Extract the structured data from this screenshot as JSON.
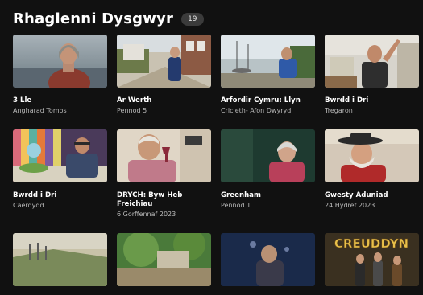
{
  "header": {
    "title": "Rhaglenni Dysgwyr",
    "count": "19"
  },
  "cards": [
    {
      "title": "3 Lle",
      "subtitle": "Angharad Tomos",
      "subtitle2": ""
    },
    {
      "title": "Ar Werth",
      "subtitle": "Pennod 5",
      "subtitle2": ""
    },
    {
      "title": "Arfordir Cymru: Llyn",
      "subtitle": "Cricieth- Afon Dwyryd",
      "subtitle2": ""
    },
    {
      "title": "Bwrdd i Dri",
      "subtitle": "Tregaron",
      "subtitle2": ""
    },
    {
      "title": "Bwrdd i Dri",
      "subtitle": "Caerdydd",
      "subtitle2": ""
    },
    {
      "title": "DRYCH: Byw Heb Freichiau",
      "subtitle": "6 Gorffennaf 2023",
      "subtitle2": ""
    },
    {
      "title": "Greenham",
      "subtitle": "Pennod 1",
      "subtitle2": ""
    },
    {
      "title": "Gwesty Aduniad",
      "subtitle": "24 Hydref 2023",
      "subtitle2": ""
    },
    {
      "title": "",
      "subtitle": "",
      "subtitle2": ""
    },
    {
      "title": "",
      "subtitle": "",
      "subtitle2": ""
    },
    {
      "title": "",
      "subtitle": "",
      "subtitle2": ""
    },
    {
      "title": "",
      "subtitle": "",
      "subtitle2": ""
    }
  ],
  "thumb_logo_text": "CREUDDYN"
}
